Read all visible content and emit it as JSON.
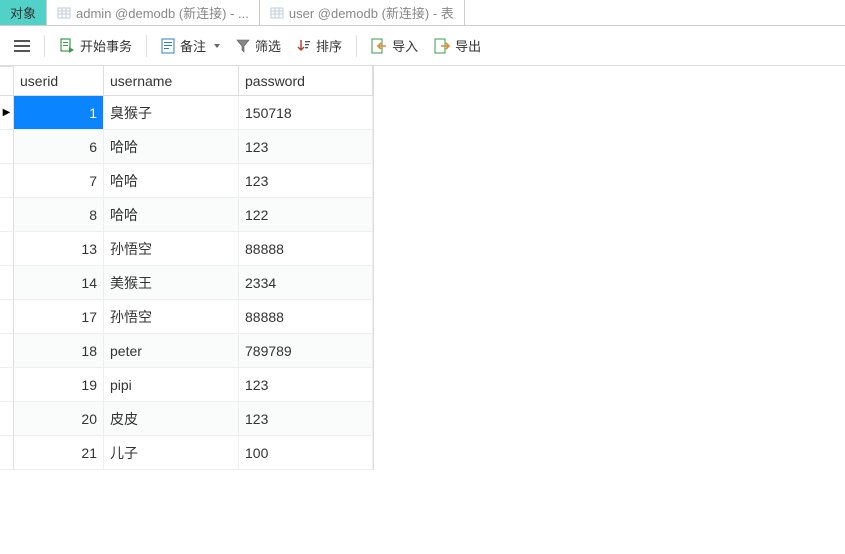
{
  "tabs": [
    {
      "label": "对象",
      "icon": null,
      "active": true
    },
    {
      "label": "admin @demodb (新连接) - ...",
      "icon": "table-icon",
      "active": false
    },
    {
      "label": "user @demodb (新连接) - 表",
      "icon": "table-icon",
      "active": false
    }
  ],
  "toolbar": {
    "menu_icon": "menu-icon",
    "begin_tx": "开始事务",
    "memo": "备注",
    "filter": "筛选",
    "sort": "排序",
    "import": "导入",
    "export": "导出"
  },
  "columns": {
    "userid": "userid",
    "username": "username",
    "password": "password"
  },
  "rows": [
    {
      "userid": "1",
      "username": "臭猴子",
      "password": "150718",
      "selected": true
    },
    {
      "userid": "6",
      "username": "哈哈",
      "password": "123"
    },
    {
      "userid": "7",
      "username": "哈哈",
      "password": "123"
    },
    {
      "userid": "8",
      "username": "哈哈",
      "password": "122"
    },
    {
      "userid": "13",
      "username": "孙悟空",
      "password": "88888"
    },
    {
      "userid": "14",
      "username": "美猴王",
      "password": "2334"
    },
    {
      "userid": "17",
      "username": "孙悟空",
      "password": "88888"
    },
    {
      "userid": "18",
      "username": "peter",
      "password": "789789"
    },
    {
      "userid": "19",
      "username": "pipi",
      "password": "123"
    },
    {
      "userid": "20",
      "username": "皮皮",
      "password": "123"
    },
    {
      "userid": "21",
      "username": "儿子",
      "password": "100"
    }
  ]
}
